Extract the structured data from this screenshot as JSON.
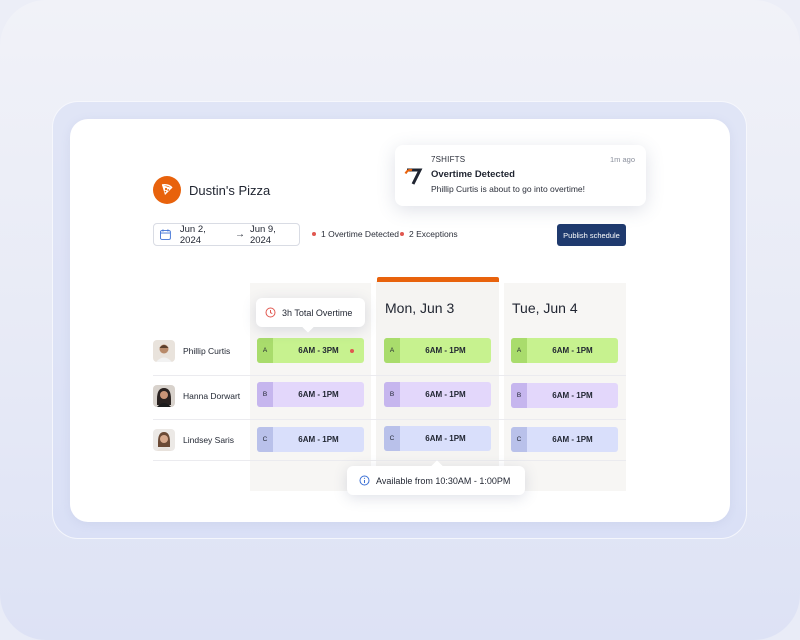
{
  "brand": {
    "name": "Dustin's Pizza",
    "logo_icon": "pizza-icon",
    "accent": "#e8620c"
  },
  "date_range": {
    "start": "Jun 2, 2024",
    "arrow": "→",
    "end": "Jun 9, 2024"
  },
  "flags": [
    {
      "label": "1 Overtime Detected",
      "color": "#e0574f"
    },
    {
      "label": "2 Exceptions",
      "color": "#e0574f"
    }
  ],
  "publish_button": {
    "label": "Publish schedule",
    "color": "#1f3a6e"
  },
  "notification": {
    "app": "7SHIFTS",
    "time": "1m ago",
    "title": "Overtime Detected",
    "body": "Phillip Curtis is about to go into overtime!"
  },
  "days": [
    {
      "label": ""
    },
    {
      "label": "Mon, Jun 3",
      "highlighted": true
    },
    {
      "label": "Tue, Jun 4"
    }
  ],
  "employees": [
    {
      "name": "Phillip Curtis"
    },
    {
      "name": "Hanna Dorwart"
    },
    {
      "name": "Lindsey Saris"
    }
  ],
  "shifts": [
    [
      {
        "tag": "A",
        "time": "6AM - 3PM",
        "overtime": true
      },
      {
        "tag": "A",
        "time": "6AM - 1PM"
      },
      {
        "tag": "A",
        "time": "6AM - 1PM"
      }
    ],
    [
      {
        "tag": "B",
        "time": "6AM - 1PM"
      },
      {
        "tag": "B",
        "time": "6AM - 1PM"
      },
      {
        "tag": "B",
        "time": "6AM - 1PM"
      }
    ],
    [
      {
        "tag": "C",
        "time": "6AM - 1PM"
      },
      {
        "tag": "C",
        "time": "6AM - 1PM"
      },
      {
        "tag": "C",
        "time": "6AM - 1PM"
      }
    ]
  ],
  "tooltips": {
    "overtime": "3h Total Overtime",
    "availability": "Available from 10:30AM - 1:00PM"
  }
}
